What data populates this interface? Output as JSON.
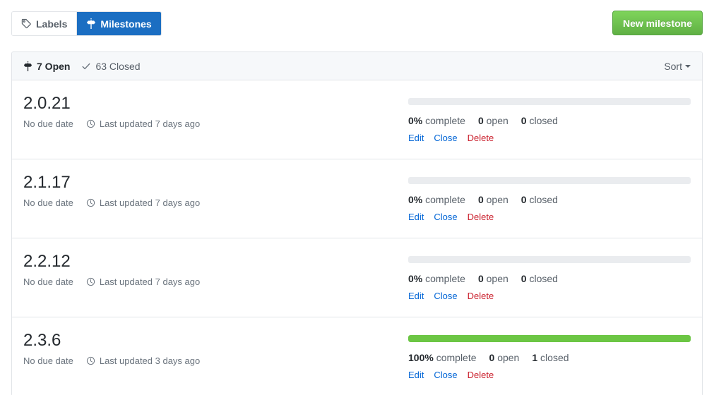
{
  "tabs": [
    {
      "label": "Labels",
      "icon": "tag-icon",
      "selected": false
    },
    {
      "label": "Milestones",
      "icon": "milestone-icon",
      "selected": true
    }
  ],
  "new_milestone_button": {
    "label": "New milestone"
  },
  "header": {
    "open": {
      "count": "7",
      "label": "7 Open",
      "icon": "milestone-icon"
    },
    "closed": {
      "count": "63",
      "label": "63 Closed",
      "icon": "check-icon"
    },
    "sort": {
      "label": "Sort",
      "icon": "chevron-down-icon"
    }
  },
  "colors": {
    "accent_blue": "#0366d6",
    "tab_selected_blue": "#1b6ec2",
    "button_green": "#60b044",
    "progress_green": "#6cc644",
    "progress_track": "#eaecef",
    "danger_red": "#cb2431",
    "muted_text": "#586069",
    "border": "#e1e4e8"
  },
  "milestones": [
    {
      "title": "2.0.21",
      "due_date": "No due date",
      "last_updated": "Last updated 7 days ago",
      "percent_complete": 0,
      "percent_label": "0%",
      "complete_label": "complete",
      "open_count": "0",
      "open_label": "open",
      "closed_count": "0",
      "closed_label": "closed",
      "actions": {
        "edit": "Edit",
        "close": "Close",
        "delete": "Delete"
      }
    },
    {
      "title": "2.1.17",
      "due_date": "No due date",
      "last_updated": "Last updated 7 days ago",
      "percent_complete": 0,
      "percent_label": "0%",
      "complete_label": "complete",
      "open_count": "0",
      "open_label": "open",
      "closed_count": "0",
      "closed_label": "closed",
      "actions": {
        "edit": "Edit",
        "close": "Close",
        "delete": "Delete"
      }
    },
    {
      "title": "2.2.12",
      "due_date": "No due date",
      "last_updated": "Last updated 7 days ago",
      "percent_complete": 0,
      "percent_label": "0%",
      "complete_label": "complete",
      "open_count": "0",
      "open_label": "open",
      "closed_count": "0",
      "closed_label": "closed",
      "actions": {
        "edit": "Edit",
        "close": "Close",
        "delete": "Delete"
      }
    },
    {
      "title": "2.3.6",
      "due_date": "No due date",
      "last_updated": "Last updated 3 days ago",
      "percent_complete": 100,
      "percent_label": "100%",
      "complete_label": "complete",
      "open_count": "0",
      "open_label": "open",
      "closed_count": "1",
      "closed_label": "closed",
      "actions": {
        "edit": "Edit",
        "close": "Close",
        "delete": "Delete"
      }
    }
  ]
}
